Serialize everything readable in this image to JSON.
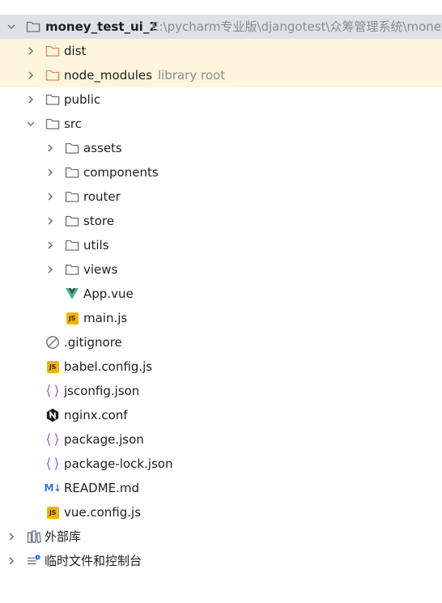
{
  "colors": {
    "root_row_bg": "#dfe1e5",
    "excluded_row_bg": "#fdf5dc",
    "folder_outline": "#6c707e",
    "excluded_folder_outline": "#e08855",
    "json_brace": "#9a6bd4",
    "vue_green": "#41b883",
    "vue_dark": "#35495e",
    "js_badge": "#f4b400",
    "markdown_blue": "#3574f0",
    "hint_text": "#8c8c8c"
  },
  "root": {
    "name": "money_test_ui_2",
    "path": "E:\\pycharm专业版\\djangotest\\众筹管理系统\\money"
  },
  "items": {
    "dist": {
      "label": "dist"
    },
    "node_modules": {
      "label": "node_modules",
      "hint": "library root"
    },
    "public": {
      "label": "public"
    },
    "src": {
      "label": "src"
    },
    "assets": {
      "label": "assets"
    },
    "components": {
      "label": "components"
    },
    "router": {
      "label": "router"
    },
    "store": {
      "label": "store"
    },
    "utils": {
      "label": "utils"
    },
    "views": {
      "label": "views"
    },
    "app_vue": {
      "label": "App.vue"
    },
    "main_js": {
      "label": "main.js"
    },
    "gitignore": {
      "label": ".gitignore"
    },
    "babel_config": {
      "label": "babel.config.js"
    },
    "jsconfig": {
      "label": "jsconfig.json"
    },
    "nginx": {
      "label": "nginx.conf"
    },
    "package_json": {
      "label": "package.json"
    },
    "package_lock": {
      "label": "package-lock.json"
    },
    "readme": {
      "label": "README.md"
    },
    "vue_config": {
      "label": "vue.config.js"
    }
  },
  "external_libraries": {
    "label": "外部库"
  },
  "scratches": {
    "label": "临时文件和控制台"
  },
  "icons": {
    "js_badge_text": "JS",
    "markdown_badge_text": "M↓"
  }
}
